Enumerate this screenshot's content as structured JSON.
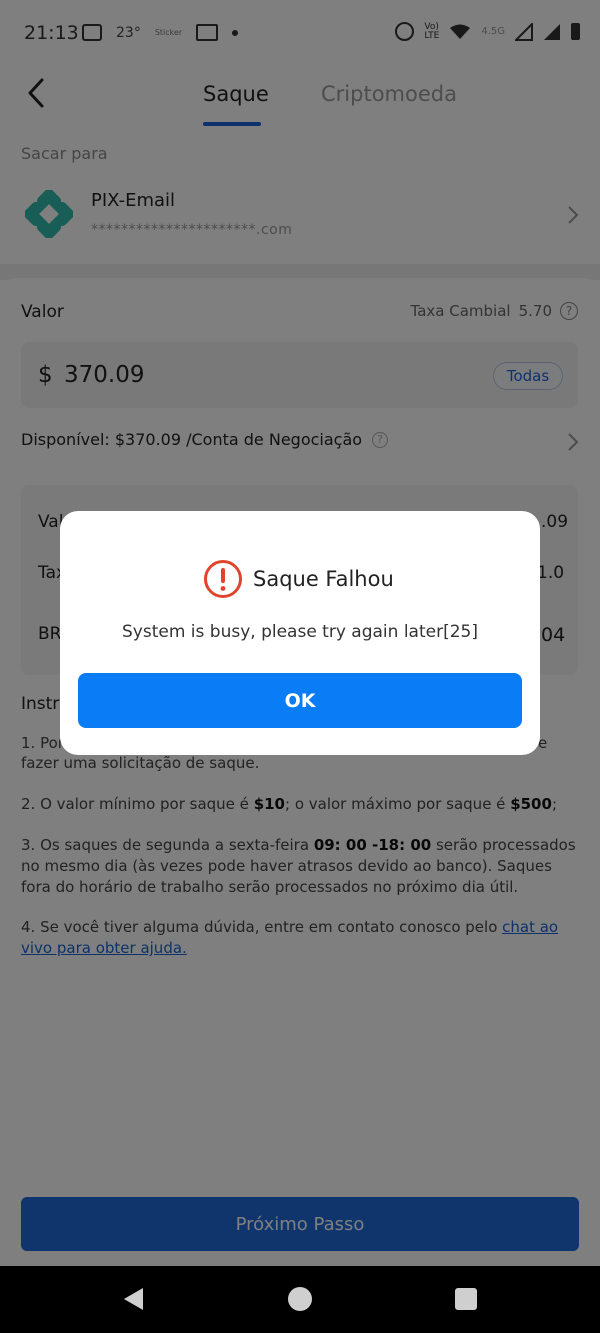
{
  "status_bar": {
    "time": "21:13",
    "temperature": "23°",
    "sticker": "Sticker",
    "network": "4.5G"
  },
  "header": {
    "tabs": [
      {
        "label": "Saque",
        "active": true
      },
      {
        "label": "Criptomoeda",
        "active": false
      }
    ]
  },
  "destination": {
    "section_label": "Sacar para",
    "method_name": "PIX-Email",
    "masked_email": "**********************.com"
  },
  "amount": {
    "label": "Valor",
    "rate_label": "Taxa Cambial",
    "rate_value": "5.70",
    "currency_symbol": "$",
    "value": "370.09",
    "all_button": "Todas",
    "available": "Disponível: $370.09 /Conta de Negociação"
  },
  "summary": {
    "rows": [
      {
        "label": "Val",
        "value": ".09"
      },
      {
        "label": "Tax",
        "value": "1.0"
      },
      {
        "label": "BR",
        "value": "04"
      }
    ]
  },
  "instructions": {
    "title": "Instr",
    "item1_part1": "1. Por",
    "item1_part2": "e",
    "item1_line2": "fazer uma solicitação de saque.",
    "item2_pre": "2. O valor mínimo por saque é ",
    "item2_min": "$10",
    "item2_mid": "; o valor máximo por saque é ",
    "item2_max": "$500",
    "item2_end": ";",
    "item3_pre": "3. Os saques de segunda a sexta-feira ",
    "item3_hours": "09: 00 -18: 00",
    "item3_post": " serão processados no mesmo dia (às vezes pode haver atrasos devido ao banco). Saques fora do horário de trabalho serão processados no próximo dia útil.",
    "item4_pre": "4. Se você tiver alguma dúvida, entre em contato conosco pelo ",
    "item4_link": "chat ao vivo para obter ajuda."
  },
  "next_button": "Próximo Passo",
  "dialog": {
    "title": "Saque Falhou",
    "message": "System is busy, please try again later[25]",
    "ok_button": "OK"
  },
  "colors": {
    "accent": "#1a63d6",
    "ok_button": "#0a7cf5",
    "error": "#e0442b",
    "pix_logo": "#32bcad"
  }
}
